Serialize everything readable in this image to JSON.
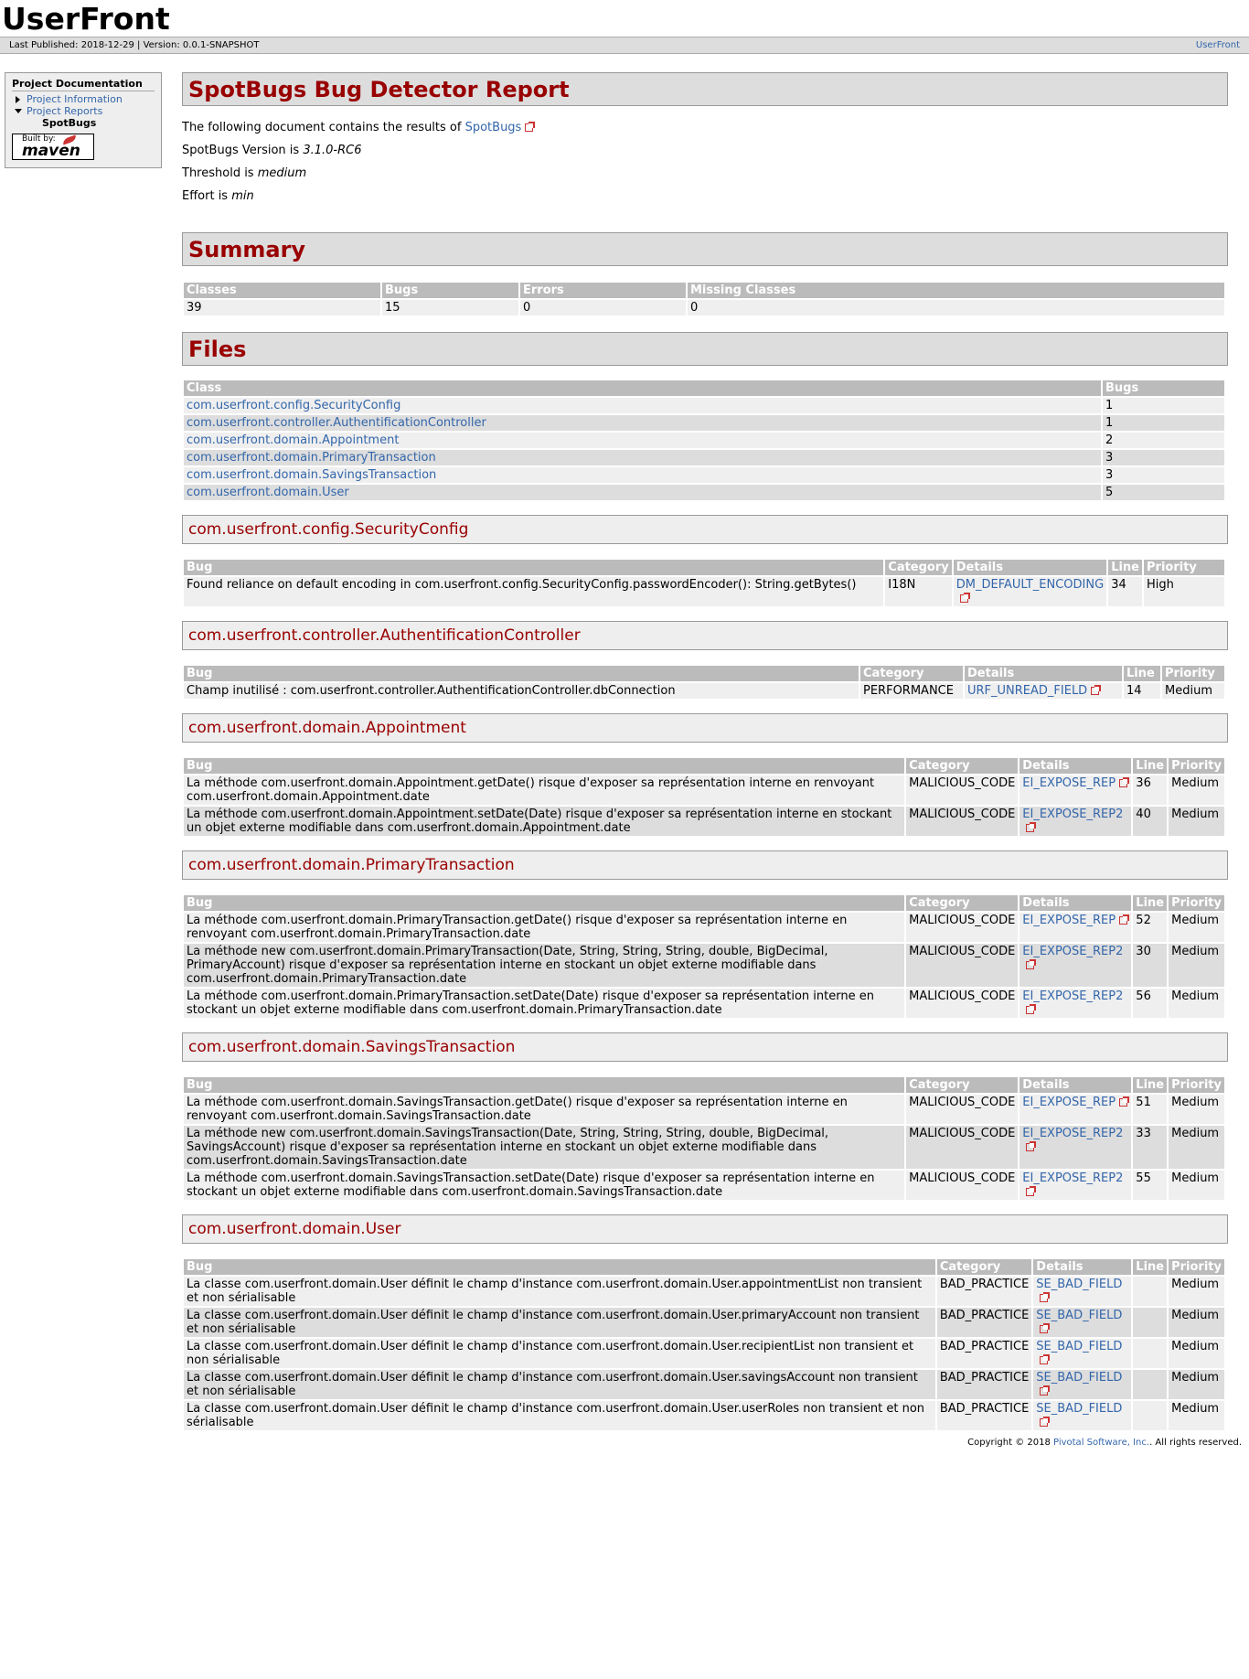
{
  "banner": {
    "title": "UserFront"
  },
  "breadcrumbs": {
    "last_published": "Last Published: 2018-12-29",
    "version": "Version: 0.0.1-SNAPSHOT",
    "right_link": "UserFront"
  },
  "sidebar": {
    "heading": "Project Documentation",
    "items": [
      {
        "label": "Project Information"
      },
      {
        "label": "Project Reports"
      },
      {
        "label": "SpotBugs"
      }
    ],
    "powered_by": {
      "built_by": "Built by:",
      "brand": "maven"
    }
  },
  "report": {
    "title": "SpotBugs Bug Detector Report",
    "intro_prefix": "The following document contains the results of ",
    "intro_link": "SpotBugs",
    "version_prefix": "SpotBugs Version is ",
    "version_value": "3.1.0-RC6",
    "threshold_prefix": "Threshold is ",
    "threshold_value": "medium",
    "effort_prefix": "Effort is ",
    "effort_value": "min"
  },
  "summary": {
    "title": "Summary",
    "headers": [
      "Classes",
      "Bugs",
      "Errors",
      "Missing Classes"
    ],
    "values": [
      "39",
      "15",
      "0",
      "0"
    ]
  },
  "files": {
    "title": "Files",
    "headers": [
      "Class",
      "Bugs"
    ],
    "rows": [
      {
        "class": "com.userfront.config.SecurityConfig",
        "bugs": "1"
      },
      {
        "class": "com.userfront.controller.AuthentificationController",
        "bugs": "1"
      },
      {
        "class": "com.userfront.domain.Appointment",
        "bugs": "2"
      },
      {
        "class": "com.userfront.domain.PrimaryTransaction",
        "bugs": "3"
      },
      {
        "class": "com.userfront.domain.SavingsTransaction",
        "bugs": "3"
      },
      {
        "class": "com.userfront.domain.User",
        "bugs": "5"
      }
    ]
  },
  "bug_headers": [
    "Bug",
    "Category",
    "Details",
    "Line",
    "Priority"
  ],
  "sections": [
    {
      "title": "com.userfront.config.SecurityConfig",
      "bugs": [
        {
          "bug": "Found reliance on default encoding in com.userfront.config.SecurityConfig.passwordEncoder(): String.getBytes()",
          "category": "I18N",
          "details": "DM_DEFAULT_ENCODING",
          "line": "34",
          "priority": "High"
        }
      ]
    },
    {
      "title": "com.userfront.controller.AuthentificationController",
      "bugs": [
        {
          "bug": "Champ inutilisé : com.userfront.controller.AuthentificationController.dbConnection",
          "category": "PERFORMANCE",
          "details": "URF_UNREAD_FIELD",
          "line": "14",
          "priority": "Medium"
        }
      ]
    },
    {
      "title": "com.userfront.domain.Appointment",
      "bugs": [
        {
          "bug": "La méthode com.userfront.domain.Appointment.getDate() risque d'exposer sa représentation interne en renvoyant com.userfront.domain.Appointment.date",
          "category": "MALICIOUS_CODE",
          "details": "EI_EXPOSE_REP",
          "line": "36",
          "priority": "Medium"
        },
        {
          "bug": "La méthode com.userfront.domain.Appointment.setDate(Date) risque d'exposer sa représentation interne en stockant un objet externe modifiable dans com.userfront.domain.Appointment.date",
          "category": "MALICIOUS_CODE",
          "details": "EI_EXPOSE_REP2",
          "line": "40",
          "priority": "Medium"
        }
      ]
    },
    {
      "title": "com.userfront.domain.PrimaryTransaction",
      "bugs": [
        {
          "bug": "La méthode com.userfront.domain.PrimaryTransaction.getDate() risque d'exposer sa représentation interne en renvoyant com.userfront.domain.PrimaryTransaction.date",
          "category": "MALICIOUS_CODE",
          "details": "EI_EXPOSE_REP",
          "line": "52",
          "priority": "Medium"
        },
        {
          "bug": "La méthode new com.userfront.domain.PrimaryTransaction(Date, String, String, String, double, BigDecimal, PrimaryAccount) risque d'exposer sa représentation interne en stockant un objet externe modifiable dans com.userfront.domain.PrimaryTransaction.date",
          "category": "MALICIOUS_CODE",
          "details": "EI_EXPOSE_REP2",
          "line": "30",
          "priority": "Medium"
        },
        {
          "bug": "La méthode com.userfront.domain.PrimaryTransaction.setDate(Date) risque d'exposer sa représentation interne en stockant un objet externe modifiable dans com.userfront.domain.PrimaryTransaction.date",
          "category": "MALICIOUS_CODE",
          "details": "EI_EXPOSE_REP2",
          "line": "56",
          "priority": "Medium"
        }
      ]
    },
    {
      "title": "com.userfront.domain.SavingsTransaction",
      "bugs": [
        {
          "bug": "La méthode com.userfront.domain.SavingsTransaction.getDate() risque d'exposer sa représentation interne en renvoyant com.userfront.domain.SavingsTransaction.date",
          "category": "MALICIOUS_CODE",
          "details": "EI_EXPOSE_REP",
          "line": "51",
          "priority": "Medium"
        },
        {
          "bug": "La méthode new com.userfront.domain.SavingsTransaction(Date, String, String, String, double, BigDecimal, SavingsAccount) risque d'exposer sa représentation interne en stockant un objet externe modifiable dans com.userfront.domain.SavingsTransaction.date",
          "category": "MALICIOUS_CODE",
          "details": "EI_EXPOSE_REP2",
          "line": "33",
          "priority": "Medium"
        },
        {
          "bug": "La méthode com.userfront.domain.SavingsTransaction.setDate(Date) risque d'exposer sa représentation interne en stockant un objet externe modifiable dans com.userfront.domain.SavingsTransaction.date",
          "category": "MALICIOUS_CODE",
          "details": "EI_EXPOSE_REP2",
          "line": "55",
          "priority": "Medium"
        }
      ]
    },
    {
      "title": "com.userfront.domain.User",
      "bugs": [
        {
          "bug": "La classe com.userfront.domain.User définit le champ d'instance com.userfront.domain.User.appointmentList non transient et non sérialisable",
          "category": "BAD_PRACTICE",
          "details": "SE_BAD_FIELD",
          "line": "",
          "priority": "Medium"
        },
        {
          "bug": "La classe com.userfront.domain.User définit le champ d'instance com.userfront.domain.User.primaryAccount non transient et non sérialisable",
          "category": "BAD_PRACTICE",
          "details": "SE_BAD_FIELD",
          "line": "",
          "priority": "Medium"
        },
        {
          "bug": "La classe com.userfront.domain.User définit le champ d'instance com.userfront.domain.User.recipientList non transient et non sérialisable",
          "category": "BAD_PRACTICE",
          "details": "SE_BAD_FIELD",
          "line": "",
          "priority": "Medium"
        },
        {
          "bug": "La classe com.userfront.domain.User définit le champ d'instance com.userfront.domain.User.savingsAccount non transient et non sérialisable",
          "category": "BAD_PRACTICE",
          "details": "SE_BAD_FIELD",
          "line": "",
          "priority": "Medium"
        },
        {
          "bug": "La classe com.userfront.domain.User définit le champ d'instance com.userfront.domain.User.userRoles non transient et non sérialisable",
          "category": "BAD_PRACTICE",
          "details": "SE_BAD_FIELD",
          "line": "",
          "priority": "Medium"
        }
      ]
    }
  ],
  "footer": {
    "prefix": "Copyright © 2018 ",
    "link": "Pivotal Software, Inc.",
    "suffix": ". All rights reserved."
  },
  "colors": {
    "heading_red": "#990000",
    "link_blue": "#3366aa",
    "header_gray": "#bbbbbb"
  }
}
